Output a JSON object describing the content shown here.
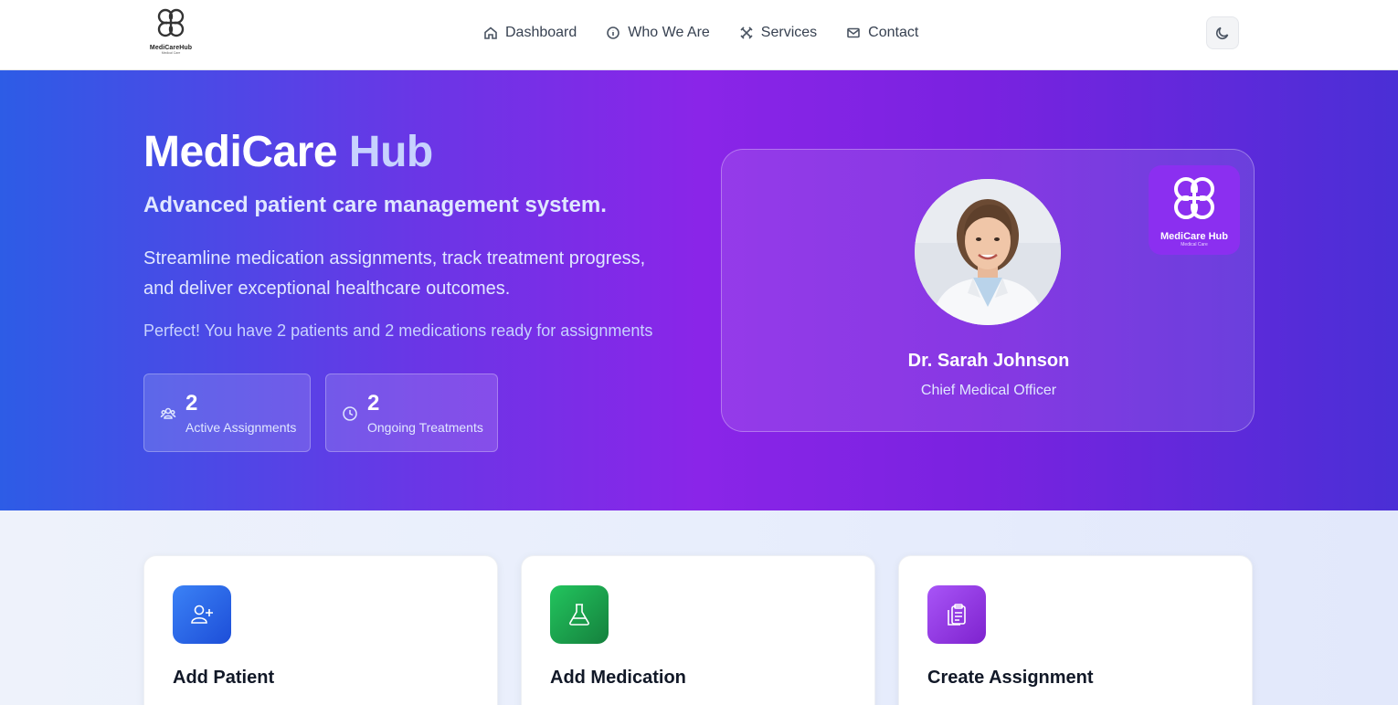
{
  "header": {
    "logo": {
      "name": "MediCareHub",
      "tagline": "Medical Care"
    },
    "nav": [
      {
        "label": "Dashboard",
        "icon": "home-icon"
      },
      {
        "label": "Who We Are",
        "icon": "info-icon"
      },
      {
        "label": "Services",
        "icon": "tools-icon"
      },
      {
        "label": "Contact",
        "icon": "mail-icon"
      }
    ],
    "theme_toggle_icon": "moon-icon"
  },
  "hero": {
    "title_main": "MediCare",
    "title_accent": "Hub",
    "subtitle": "Advanced patient care management system.",
    "description": "Streamline medication assignments, track treatment progress, and deliver exceptional healthcare outcomes.",
    "status": "Perfect! You have 2 patients and 2 medications ready for assignments",
    "stats": [
      {
        "value": "2",
        "label": "Active Assignments",
        "icon": "users-icon"
      },
      {
        "value": "2",
        "label": "Ongoing Treatments",
        "icon": "clock-icon"
      }
    ]
  },
  "profile": {
    "name": "Dr. Sarah Johnson",
    "role": "Chief Medical Officer",
    "badge": {
      "name": "MediCare Hub",
      "tagline": "Medical Care"
    }
  },
  "actions": [
    {
      "title": "Add Patient",
      "icon": "user-plus-icon",
      "color": "#2563eb"
    },
    {
      "title": "Add Medication",
      "icon": "flask-icon",
      "color": "#16a34a"
    },
    {
      "title": "Create Assignment",
      "icon": "clipboard-icon",
      "color": "#9333ea"
    }
  ],
  "colors": {
    "hero_gradient_start": "#2d5ce6",
    "hero_gradient_mid": "#8a25e8",
    "hero_gradient_end": "#4a2fd6",
    "title_accent": "#c7d2fe"
  }
}
